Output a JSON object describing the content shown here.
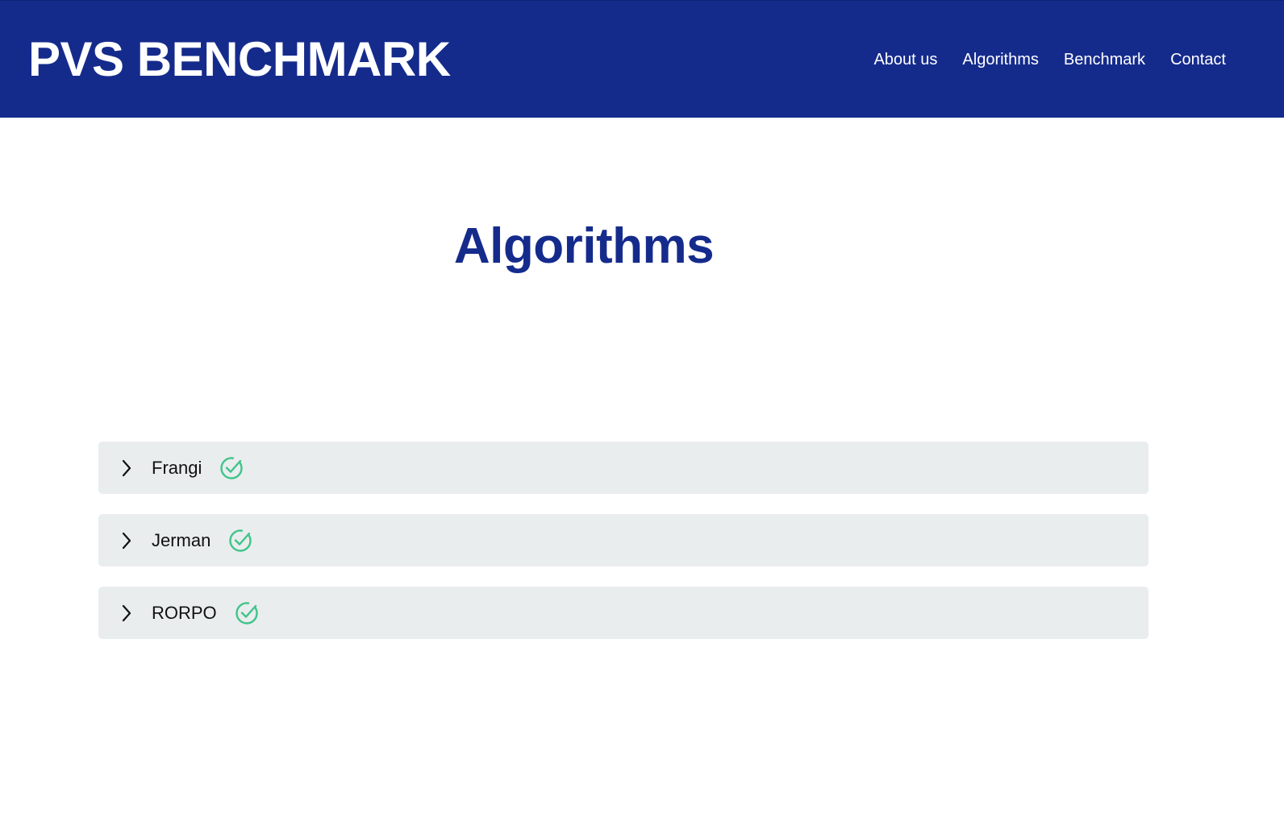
{
  "header": {
    "brand": "PVS BENCHMARK",
    "nav": [
      "About us",
      "Algorithms",
      "Benchmark",
      "Contact"
    ]
  },
  "main": {
    "title": "Algorithms",
    "algorithms": [
      {
        "name": "Frangi",
        "status_icon": "check-circle-icon",
        "expanded": false
      },
      {
        "name": "Jerman",
        "status_icon": "check-circle-icon",
        "expanded": false
      },
      {
        "name": "RORPO",
        "status_icon": "check-circle-icon",
        "expanded": false
      }
    ]
  },
  "colors": {
    "header_bg": "#152b8c",
    "title": "#152b8c",
    "accordion_bg": "#e9eded",
    "check": "#3fc48a"
  }
}
